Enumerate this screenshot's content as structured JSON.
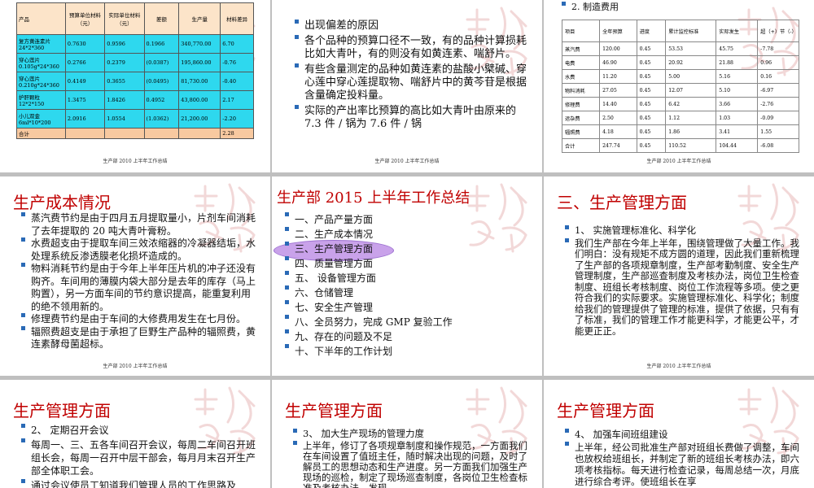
{
  "footer": "生产部 2010 上半年工作总结",
  "slide1": {
    "headers": [
      "产品",
      "预算单位材料（元）",
      "实际单位材料（元）",
      "差额",
      "生产量",
      "材料差异"
    ],
    "rows": [
      [
        "复方黄连素片 24*2*360",
        "0.7630",
        "0.9596",
        "0.1966",
        "340,770.00",
        "6.70"
      ],
      [
        "穿心莲片 0.105g*24*360",
        "0.2766",
        "0.2379",
        "(0.0387)",
        "195,860.00",
        "-0.76"
      ],
      [
        "穿心莲片 0.210g*24*360",
        "0.4149",
        "0.3655",
        "(0.0495)",
        "81,730.00",
        "-0.40"
      ],
      [
        "护肝颗粒 12*2*150",
        "1.3475",
        "1.8426",
        "0.4952",
        "43,800.00",
        "2.17"
      ],
      [
        "小儿双金 6ml*10*200",
        "2.0916",
        "1.0554",
        "(1.0362)",
        "21,200.00",
        "-2.20"
      ]
    ],
    "total": [
      "合计",
      "",
      "",
      "",
      "",
      "2.28"
    ]
  },
  "slide2": {
    "title": "生产成本情况",
    "bullets": [
      "出现偏差的原因",
      "各个品种的预算口径不一致，有的品种计算损耗比如大青叶，有的则没有如黄连素、喘舒片。",
      "有些含量测定的品种如黄连素的盐酸小檗碱、穿心莲中穿心莲提取物、喘舒片中的黄芩苷是根据含量确定投料量。",
      "实际的产出率比预算的高比如大青叶由原来的 7.3 件 / 锅为 7.6 件 / 锅"
    ]
  },
  "slide3": {
    "heading": "2. 制造费用",
    "headers": [
      "项目",
      "全年预算",
      "进度",
      "累计监控标准",
      "实际发生",
      "超（+）节（-）"
    ],
    "rows": [
      [
        "蒸汽费",
        "120.00",
        "0.45",
        "53.53",
        "45.75",
        "-7.78"
      ],
      [
        "电费",
        "46.90",
        "0.45",
        "20.92",
        "21.88",
        "0.96"
      ],
      [
        "水费",
        "11.20",
        "0.45",
        "5.00",
        "5.16",
        "0.16"
      ],
      [
        "物料消耗",
        "27.05",
        "0.45",
        "12.07",
        "5.10",
        "-6.97"
      ],
      [
        "修理费",
        "14.40",
        "0.45",
        "6.42",
        "3.66",
        "-2.76"
      ],
      [
        "运杂费",
        "2.50",
        "0.45",
        "1.12",
        "1.03",
        "-0.09"
      ],
      [
        "辐照费",
        "4.18",
        "0.45",
        "1.86",
        "3.41",
        "1.55"
      ],
      [
        "合计",
        "247.74",
        "0.45",
        "110.52",
        "104.44",
        "-6.08"
      ]
    ]
  },
  "slide4": {
    "title": "生产成本情况",
    "bullets": [
      "蒸汽费节约是由于四月五月提取量小，片剂车间消耗了去年提取的 20 吨大青叶膏粉。",
      "水费超支由于提取车间三效浓缩器的冷凝器结垢，水处理系统反渗透膜老化损坏造成的。",
      "物料消耗节约是由于今年上半年压片机的冲子还没有购齐。车间用的薄膜内袋大部分是去年的库存（马上购置），另一方面车间的节约意识提高，能重复利用的绝不领用新的。",
      "修理费节约是由于车间的大修费用发生在七月份。",
      "辐照费超支是由于承担了巨野生产品种的辐照费，黄连素酵母菌超标。"
    ]
  },
  "slide5": {
    "title": "生产部 2015 上半年工作总结",
    "items": [
      "一、产品产量方面",
      "二、生产成本情况",
      "三、生产管理方面",
      "四、质量管理方面",
      "五、 设备管理方面",
      "六、仓储管理",
      "七、安全生产管理",
      "八、全员努力，完成 GMP 复验工作",
      "九、存在的问题及不足",
      "十、下半年的工作计划"
    ]
  },
  "slide6": {
    "title": "三、生产管理方面",
    "bullets": [
      "1、 实施管理标准化、科学化",
      "我们生产部在今年上半年，围绕管理做了大量工作。我们明白：没有规矩不成方圆的道理，因此我们重新梳理了生产部的各项规章制度，生产部考勤制度、安全生产管理制度，生产部巡查制度及考核办法，岗位卫生检查制度、班组长考核制度、岗位工作流程等多项。使之更符合我们的实际要求。实施管理标准化、科学化；制度给我们的管理提供了管理的标准，提供了依据，只有有了标准，我们的管理工作才能更科学，才能更公平，才能更正正。"
    ]
  },
  "slide7": {
    "title": "生产管理方面",
    "bullets": [
      "2、 定期召开会议",
      "每周一、三、五各车间召开会议，每周二车间召开班组长会，每周一召开中层干部会，每月月末召开生产部全体职工会。",
      "通过会议使员工知道我们管理人员的工作思路及"
    ]
  },
  "slide8": {
    "title": "生产管理方面",
    "bullets": [
      "3、 加大生产现场的管理力度",
      "上半年，修订了各项规章制度和操作规范，一方面我们在车间设置了值班主任，随时解决出现的问题，及时了解员工的思想动态和生产进度。另一方面我们加强生产现场的巡检，制定了现场巡查制度，各岗位卫生检查标准及考核办法，发现"
    ]
  },
  "slide9": {
    "title": "生产管理方面",
    "bullets": [
      "4、 加强车间班组建设",
      "上半年，经公司批准生产部对班组长费做了调整，车间也放权给班组长，并制定了新的班组长考核办法，即六项考核指标。每天进行检查记录，每周总结一次，月底进行综合考评。使班组长在享"
    ]
  }
}
